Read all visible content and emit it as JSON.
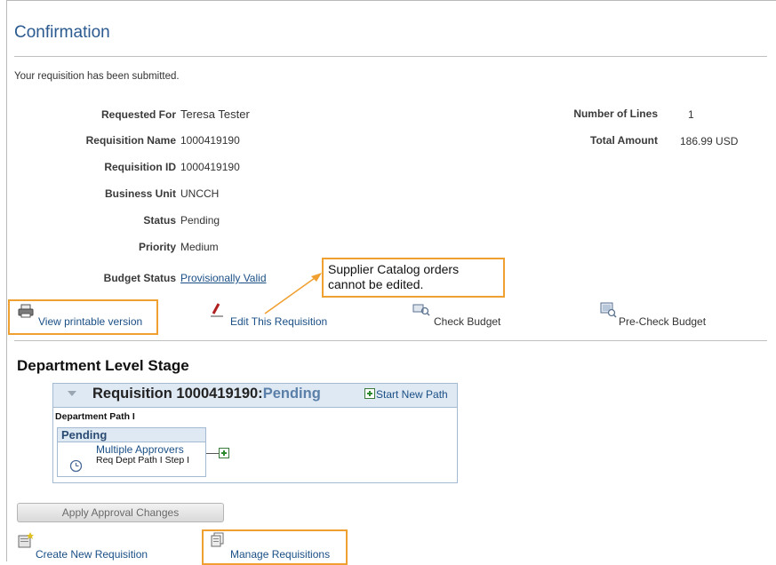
{
  "page": {
    "title": "Confirmation",
    "submitted_message": "Your requisition has been submitted."
  },
  "fields": {
    "requested_for": {
      "label": "Requested For",
      "value": "Teresa Tester"
    },
    "requisition_name": {
      "label": "Requisition Name",
      "value": "1000419190"
    },
    "requisition_id": {
      "label": "Requisition ID",
      "value": "1000419190"
    },
    "business_unit": {
      "label": "Business Unit",
      "value": "UNCCH"
    },
    "status": {
      "label": "Status",
      "value": "Pending"
    },
    "priority": {
      "label": "Priority",
      "value": "Medium"
    },
    "budget_status": {
      "label": "Budget Status",
      "value": "Provisionally Valid"
    },
    "number_of_lines": {
      "label": "Number of Lines",
      "value": "1"
    },
    "total_amount": {
      "label": "Total Amount",
      "value": "186.99",
      "currency": "USD"
    }
  },
  "callout": {
    "line1": "Supplier Catalog orders",
    "line2": "cannot be edited."
  },
  "actions": {
    "view_printable": "View printable version",
    "edit_requisition": "Edit This Requisition",
    "check_budget": "Check Budget",
    "pre_check_budget": "Pre-Check Budget"
  },
  "approval": {
    "section_title": "Department Level Stage",
    "requisition_label": "Requisition 1000419190:",
    "requisition_status": "Pending",
    "start_new_path": "Start New Path",
    "department_path": "Department Path I",
    "step_status": "Pending",
    "approvers": "Multiple Approvers",
    "step_name": "Req Dept Path I Step I",
    "apply_button": "Apply Approval Changes"
  },
  "bottom_links": {
    "create_new": "Create New Requisition",
    "manage": "Manage Requisitions"
  },
  "colors": {
    "highlight": "#f0a030",
    "link": "#1a4f86",
    "title": "#2a5a8f"
  },
  "icons": [
    "printer-icon",
    "pencil-icon",
    "check-budget-icon",
    "pre-check-budget-icon",
    "collapse-arrow-icon",
    "add-path-icon",
    "clock-icon",
    "add-step-icon",
    "new-requisition-icon",
    "manage-requisitions-icon"
  ]
}
